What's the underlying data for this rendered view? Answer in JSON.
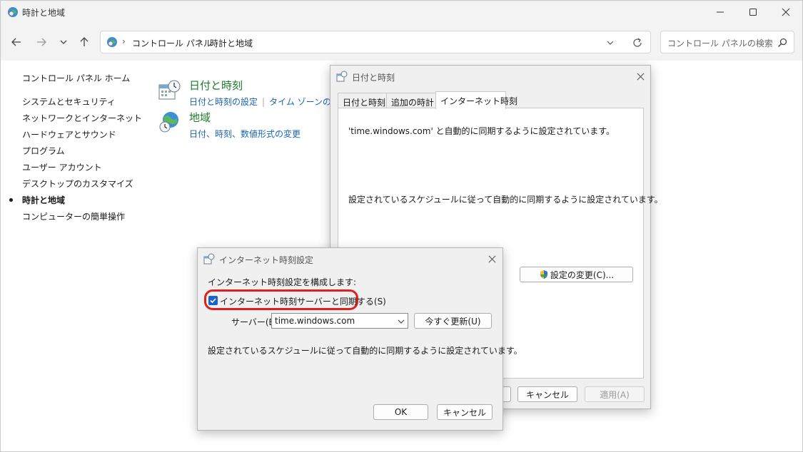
{
  "window": {
    "title": "時計と地域",
    "controls": [
      "minimize",
      "maximize",
      "close"
    ]
  },
  "address_bar": {
    "crumbs": [
      "コントロール パネル",
      "時計と地域"
    ],
    "separator": "›"
  },
  "search": {
    "placeholder": "コントロール パネルの検索"
  },
  "left_nav": {
    "home": "コントロール パネル ホーム",
    "items": [
      "システムとセキュリティ",
      "ネットワークとインターネット",
      "ハードウェアとサウンド",
      "プログラム",
      "ユーザー アカウント",
      "デスクトップのカスタマイズ",
      "時計と地域",
      "コンピューターの簡単操作"
    ],
    "current": "時計と地域"
  },
  "categories": [
    {
      "title": "日付と時刻",
      "links": [
        "日付と時刻の設定",
        "タイム ゾーンの変更"
      ]
    },
    {
      "title": "地域",
      "links": [
        "日付、時刻、数値形式の変更"
      ]
    }
  ],
  "datetime_dialog": {
    "title": "日付と時刻",
    "tabs": [
      "日付と時刻",
      "追加の時計",
      "インターネット時刻"
    ],
    "active_tab": "インターネット時刻",
    "sync_text": "'time.windows.com' と自動的に同期するように設定されています。",
    "schedule_text": "設定されているスケジュールに従って自動的に同期するように設定されています。",
    "change_settings_button": "設定の変更(C)...",
    "cancel_button": "キャンセル",
    "apply_button": "適用(A)"
  },
  "internet_time_dialog": {
    "title": "インターネット時刻設定",
    "configure_label": "インターネット時刻設定を構成します:",
    "sync_checkbox_label": "インターネット時刻サーバーと同期する(S)",
    "sync_checked": true,
    "server_label": "サーバー(E):",
    "server_value": "time.windows.com",
    "update_now_button": "今すぐ更新(U)",
    "schedule_text": "設定されているスケジュールに従って自動的に同期するように設定されています。",
    "ok_button": "OK",
    "cancel_button": "キャンセル"
  },
  "colors": {
    "highlight": "#e01f1f",
    "category_title": "#1e7a2a",
    "link": "#1a64b5",
    "checkbox": "#1a64c8"
  }
}
